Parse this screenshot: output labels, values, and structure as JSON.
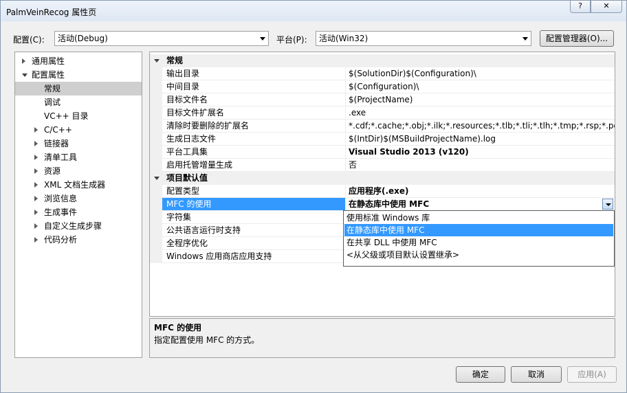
{
  "window": {
    "title": "PalmVeinRecog 属性页",
    "help_label": "?",
    "close_label": "✕"
  },
  "toolbar": {
    "config_label": "配置(C):",
    "config_value": "活动(Debug)",
    "platform_label": "平台(P):",
    "platform_value": "活动(Win32)",
    "manager_button": "配置管理器(O)..."
  },
  "tree": {
    "items": [
      {
        "label": "通用属性",
        "level": 0,
        "expander": "collapsed"
      },
      {
        "label": "配置属性",
        "level": 0,
        "expander": "expanded"
      },
      {
        "label": "常规",
        "level": 1,
        "expander": "none",
        "selected": true
      },
      {
        "label": "调试",
        "level": 1,
        "expander": "none"
      },
      {
        "label": "VC++ 目录",
        "level": 1,
        "expander": "none"
      },
      {
        "label": "C/C++",
        "level": 1,
        "expander": "collapsed"
      },
      {
        "label": "链接器",
        "level": 1,
        "expander": "collapsed"
      },
      {
        "label": "清单工具",
        "level": 1,
        "expander": "collapsed"
      },
      {
        "label": "资源",
        "level": 1,
        "expander": "collapsed"
      },
      {
        "label": "XML 文档生成器",
        "level": 1,
        "expander": "collapsed"
      },
      {
        "label": "浏览信息",
        "level": 1,
        "expander": "collapsed"
      },
      {
        "label": "生成事件",
        "level": 1,
        "expander": "collapsed"
      },
      {
        "label": "自定义生成步骤",
        "level": 1,
        "expander": "collapsed"
      },
      {
        "label": "代码分析",
        "level": 1,
        "expander": "collapsed"
      }
    ]
  },
  "grid": {
    "sections": [
      {
        "title": "常规",
        "rows": [
          {
            "name": "输出目录",
            "value": "$(SolutionDir)$(Configuration)\\"
          },
          {
            "name": "中间目录",
            "value": "$(Configuration)\\"
          },
          {
            "name": "目标文件名",
            "value": "$(ProjectName)"
          },
          {
            "name": "目标文件扩展名",
            "value": ".exe"
          },
          {
            "name": "清除时要删除的扩展名",
            "value": "*.cdf;*.cache;*.obj;*.ilk;*.resources;*.tlb;*.tli;*.tlh;*.tmp;*.rsp;*.pgc;*.pg"
          },
          {
            "name": "生成日志文件",
            "value": "$(IntDir)$(MSBuildProjectName).log"
          },
          {
            "name": "平台工具集",
            "value": "Visual Studio 2013 (v120)",
            "bold": true
          },
          {
            "name": "启用托管增量生成",
            "value": "否"
          }
        ]
      },
      {
        "title": "项目默认值",
        "rows": [
          {
            "name": "配置类型",
            "value": "应用程序(.exe)",
            "bold": true
          },
          {
            "name": "MFC 的使用",
            "value": "在静态库中使用 MFC",
            "bold": true,
            "highlight": true,
            "editing": true
          },
          {
            "name": "字符集",
            "value": ""
          },
          {
            "name": "公共语言运行时支持",
            "value": ""
          },
          {
            "name": "全程序优化",
            "value": ""
          },
          {
            "name": "Windows 应用商店应用支持",
            "value": ""
          }
        ]
      }
    ],
    "dropdown_options": [
      {
        "label": "使用标准 Windows 库"
      },
      {
        "label": "在静态库中使用 MFC",
        "selected": true
      },
      {
        "label": "在共享 DLL 中使用 MFC"
      },
      {
        "label": "<从父级或项目默认设置继承>"
      }
    ]
  },
  "description": {
    "title": "MFC 的使用",
    "text": "指定配置使用 MFC 的方式。"
  },
  "buttons": {
    "ok": "确定",
    "cancel": "取消",
    "apply": "应用(A)"
  }
}
